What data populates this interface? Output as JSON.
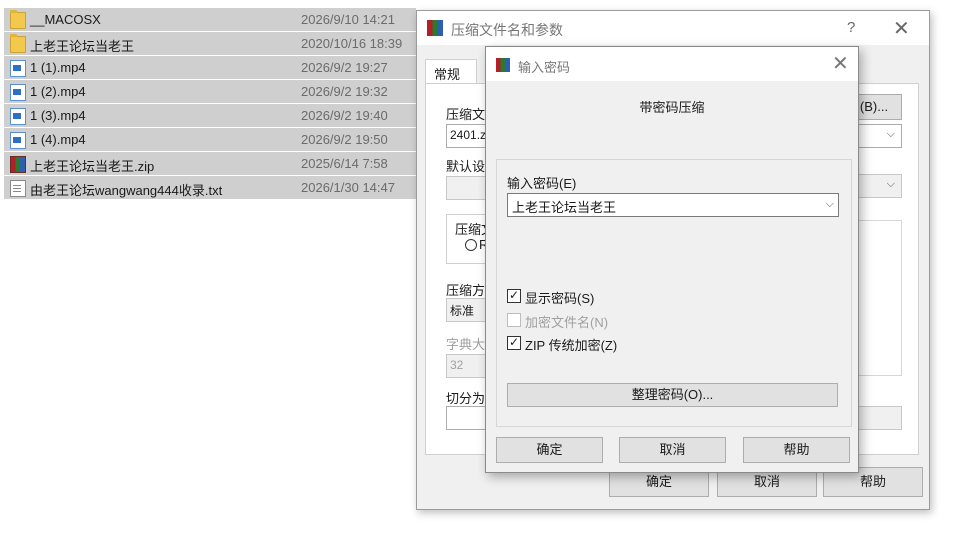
{
  "files": [
    {
      "name": "__MACOSX",
      "date": "2026/9/10 14:21",
      "icon": "folder-icon"
    },
    {
      "name": "上老王论坛当老王",
      "date": "2020/10/16 18:39",
      "icon": "folder-icon"
    },
    {
      "name": "1 (1).mp4",
      "date": "2026/9/2 19:27",
      "icon": "video-file-icon"
    },
    {
      "name": "1 (2).mp4",
      "date": "2026/9/2 19:32",
      "icon": "video-file-icon"
    },
    {
      "name": "1 (3).mp4",
      "date": "2026/9/2 19:40",
      "icon": "video-file-icon"
    },
    {
      "name": "1 (4).mp4",
      "date": "2026/9/2 19:50",
      "icon": "video-file-icon"
    },
    {
      "name": "上老王论坛当老王.zip",
      "date": "2025/6/14 7:58",
      "icon": "winrar-archive-icon"
    },
    {
      "name": "由老王论坛wangwang444收录.txt",
      "date": "2026/1/30 14:47",
      "icon": "text-file-icon"
    }
  ],
  "main_dialog": {
    "title": "压缩文件名和参数",
    "help_glyph": "?",
    "close_glyph": "✕",
    "tab_general": "常规",
    "archive_name_label": "压缩文",
    "archive_name_value": "2401.z",
    "browse_button": "(B)...",
    "default_settings_label": "默认设",
    "format_group_label": "压缩文",
    "format_radio_char": "R",
    "method_label": "压缩方",
    "method_value": "标准",
    "dict_label": "字典大",
    "dict_value": "32",
    "split_label": "切分为",
    "ok_button": "确定",
    "cancel_button": "取消",
    "help_button": "帮助"
  },
  "password_dialog": {
    "title": "输入密码",
    "close_glyph": "✕",
    "heading": "带密码压缩",
    "enter_label": "输入密码(E)",
    "password_value": "上老王论坛当老王",
    "show_password_label": "显示密码(S)",
    "show_password_checked": true,
    "encrypt_names_label": "加密文件名(N)",
    "encrypt_names_checked": false,
    "zip_legacy_label": "ZIP 传统加密(Z)",
    "zip_legacy_checked": true,
    "organize_button": "整理密码(O)...",
    "ok_button": "确定",
    "cancel_button": "取消",
    "help_button": "帮助"
  },
  "colors": {
    "selection": "#cfcfcf",
    "dialog_bg": "#f0f0f0",
    "button_bg": "#e1e1e1"
  }
}
